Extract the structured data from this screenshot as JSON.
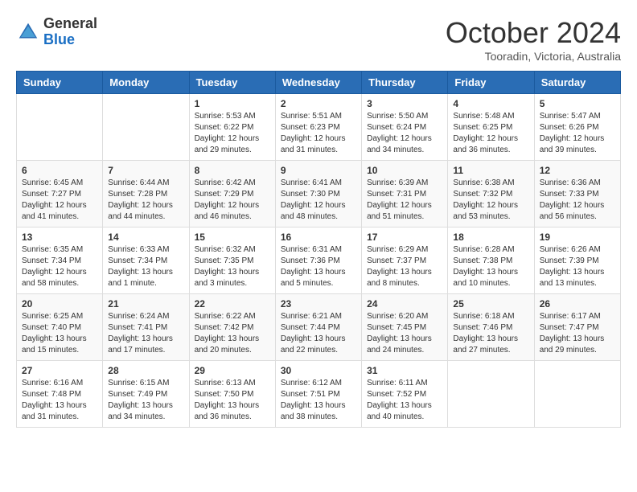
{
  "header": {
    "logo_general": "General",
    "logo_blue": "Blue",
    "month": "October 2024",
    "location": "Tooradin, Victoria, Australia"
  },
  "weekdays": [
    "Sunday",
    "Monday",
    "Tuesday",
    "Wednesday",
    "Thursday",
    "Friday",
    "Saturday"
  ],
  "weeks": [
    [
      {
        "day": "",
        "empty": true
      },
      {
        "day": "",
        "empty": true
      },
      {
        "day": "1",
        "sunrise": "5:53 AM",
        "sunset": "6:22 PM",
        "daylight": "12 hours and 29 minutes."
      },
      {
        "day": "2",
        "sunrise": "5:51 AM",
        "sunset": "6:23 PM",
        "daylight": "12 hours and 31 minutes."
      },
      {
        "day": "3",
        "sunrise": "5:50 AM",
        "sunset": "6:24 PM",
        "daylight": "12 hours and 34 minutes."
      },
      {
        "day": "4",
        "sunrise": "5:48 AM",
        "sunset": "6:25 PM",
        "daylight": "12 hours and 36 minutes."
      },
      {
        "day": "5",
        "sunrise": "5:47 AM",
        "sunset": "6:26 PM",
        "daylight": "12 hours and 39 minutes."
      }
    ],
    [
      {
        "day": "6",
        "sunrise": "6:45 AM",
        "sunset": "7:27 PM",
        "daylight": "12 hours and 41 minutes."
      },
      {
        "day": "7",
        "sunrise": "6:44 AM",
        "sunset": "7:28 PM",
        "daylight": "12 hours and 44 minutes."
      },
      {
        "day": "8",
        "sunrise": "6:42 AM",
        "sunset": "7:29 PM",
        "daylight": "12 hours and 46 minutes."
      },
      {
        "day": "9",
        "sunrise": "6:41 AM",
        "sunset": "7:30 PM",
        "daylight": "12 hours and 48 minutes."
      },
      {
        "day": "10",
        "sunrise": "6:39 AM",
        "sunset": "7:31 PM",
        "daylight": "12 hours and 51 minutes."
      },
      {
        "day": "11",
        "sunrise": "6:38 AM",
        "sunset": "7:32 PM",
        "daylight": "12 hours and 53 minutes."
      },
      {
        "day": "12",
        "sunrise": "6:36 AM",
        "sunset": "7:33 PM",
        "daylight": "12 hours and 56 minutes."
      }
    ],
    [
      {
        "day": "13",
        "sunrise": "6:35 AM",
        "sunset": "7:34 PM",
        "daylight": "12 hours and 58 minutes."
      },
      {
        "day": "14",
        "sunrise": "6:33 AM",
        "sunset": "7:34 PM",
        "daylight": "13 hours and 1 minute."
      },
      {
        "day": "15",
        "sunrise": "6:32 AM",
        "sunset": "7:35 PM",
        "daylight": "13 hours and 3 minutes."
      },
      {
        "day": "16",
        "sunrise": "6:31 AM",
        "sunset": "7:36 PM",
        "daylight": "13 hours and 5 minutes."
      },
      {
        "day": "17",
        "sunrise": "6:29 AM",
        "sunset": "7:37 PM",
        "daylight": "13 hours and 8 minutes."
      },
      {
        "day": "18",
        "sunrise": "6:28 AM",
        "sunset": "7:38 PM",
        "daylight": "13 hours and 10 minutes."
      },
      {
        "day": "19",
        "sunrise": "6:26 AM",
        "sunset": "7:39 PM",
        "daylight": "13 hours and 13 minutes."
      }
    ],
    [
      {
        "day": "20",
        "sunrise": "6:25 AM",
        "sunset": "7:40 PM",
        "daylight": "13 hours and 15 minutes."
      },
      {
        "day": "21",
        "sunrise": "6:24 AM",
        "sunset": "7:41 PM",
        "daylight": "13 hours and 17 minutes."
      },
      {
        "day": "22",
        "sunrise": "6:22 AM",
        "sunset": "7:42 PM",
        "daylight": "13 hours and 20 minutes."
      },
      {
        "day": "23",
        "sunrise": "6:21 AM",
        "sunset": "7:44 PM",
        "daylight": "13 hours and 22 minutes."
      },
      {
        "day": "24",
        "sunrise": "6:20 AM",
        "sunset": "7:45 PM",
        "daylight": "13 hours and 24 minutes."
      },
      {
        "day": "25",
        "sunrise": "6:18 AM",
        "sunset": "7:46 PM",
        "daylight": "13 hours and 27 minutes."
      },
      {
        "day": "26",
        "sunrise": "6:17 AM",
        "sunset": "7:47 PM",
        "daylight": "13 hours and 29 minutes."
      }
    ],
    [
      {
        "day": "27",
        "sunrise": "6:16 AM",
        "sunset": "7:48 PM",
        "daylight": "13 hours and 31 minutes."
      },
      {
        "day": "28",
        "sunrise": "6:15 AM",
        "sunset": "7:49 PM",
        "daylight": "13 hours and 34 minutes."
      },
      {
        "day": "29",
        "sunrise": "6:13 AM",
        "sunset": "7:50 PM",
        "daylight": "13 hours and 36 minutes."
      },
      {
        "day": "30",
        "sunrise": "6:12 AM",
        "sunset": "7:51 PM",
        "daylight": "13 hours and 38 minutes."
      },
      {
        "day": "31",
        "sunrise": "6:11 AM",
        "sunset": "7:52 PM",
        "daylight": "13 hours and 40 minutes."
      },
      {
        "day": "",
        "empty": true
      },
      {
        "day": "",
        "empty": true
      }
    ]
  ]
}
